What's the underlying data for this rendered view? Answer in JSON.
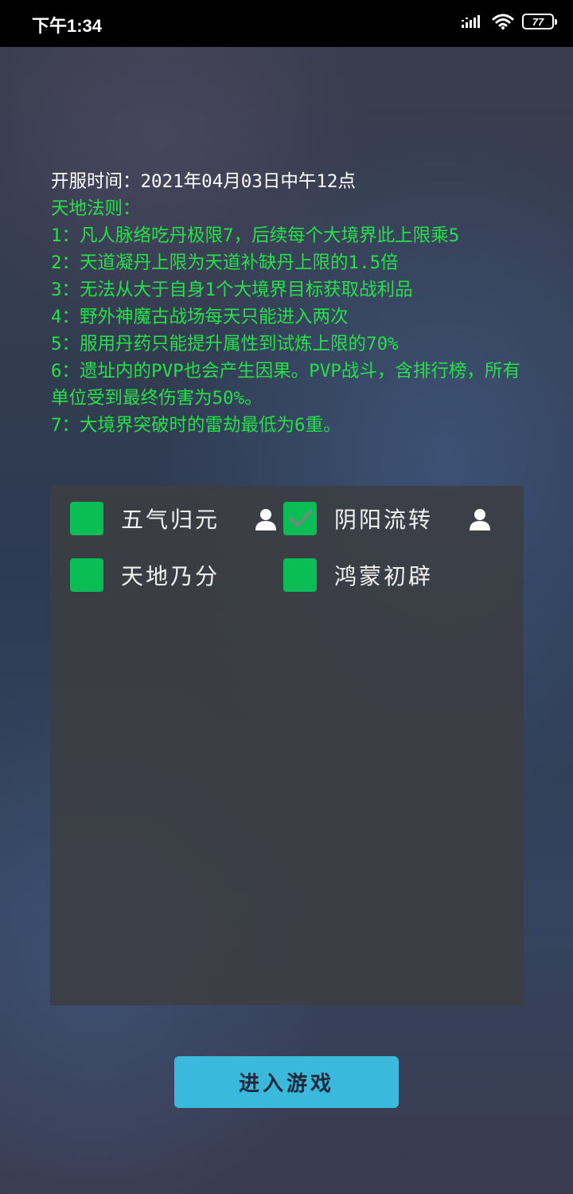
{
  "status_bar": {
    "time": "下午1:34",
    "battery": "77",
    "icons": [
      "signal-icon",
      "wifi-icon",
      "battery-icon"
    ]
  },
  "notice": {
    "server_time": "开服时间：2021年04月03日中午12点",
    "rules_title": "天地法则：",
    "rules": [
      "1：凡人脉络吃丹极限7，后续每个大境界此上限乘5",
      "2：天道凝丹上限为天道补缺丹上限的1.5倍",
      "3：无法从大于自身1个大境界目标获取战利品",
      "4：野外神魔古战场每天只能进入两次",
      "5：服用丹药只能提升属性到试炼上限的70%",
      "6：遗址内的PVP也会产生因果。PVP战斗，含排行榜，所有单位受到最终伤害为50%。",
      "7：大境界突破时的雷劫最低为6重。"
    ],
    "colors": {
      "rules": "#26e04a",
      "server_time": "#ffffff"
    }
  },
  "servers": [
    {
      "label": "五气归元",
      "checked": false,
      "has_user_icon": true
    },
    {
      "label": "阴阳流转",
      "checked": true,
      "has_user_icon": true
    },
    {
      "label": "天地乃分",
      "checked": false,
      "has_user_icon": false
    },
    {
      "label": "鸿蒙初辟",
      "checked": false,
      "has_user_icon": false
    }
  ],
  "enter_button": {
    "label": "进入游戏",
    "color": "#3ab9dd"
  },
  "accent": {
    "checkbox": "#0bbd55"
  }
}
